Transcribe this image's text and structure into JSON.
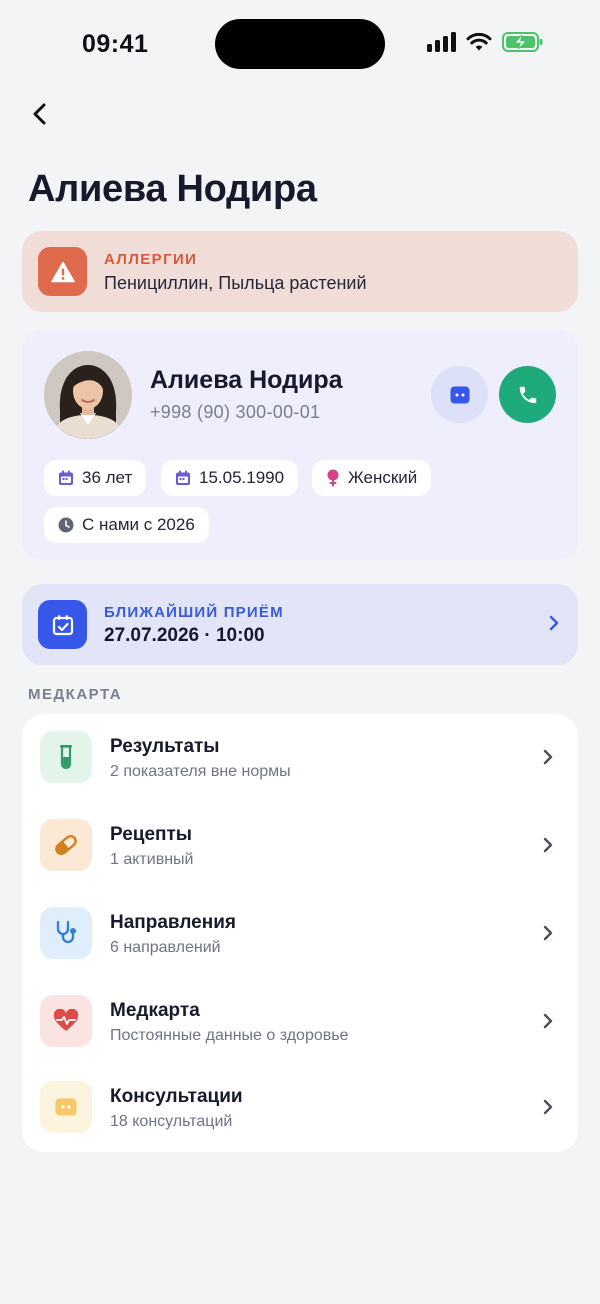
{
  "status_bar": {
    "time": "09:41"
  },
  "header": {
    "title": "Алиева Нодира"
  },
  "allergy": {
    "title": "АЛЛЕРГИИ",
    "text": "Пенициллин, Пыльца растений",
    "accent": "#df6a4c",
    "icon": "warning-icon"
  },
  "profile": {
    "name": "Алиева Нодира",
    "phone": "+998 (90) 300-00-01",
    "chips": {
      "age": "36 лет",
      "birthdate": "15.05.1990",
      "gender": "Женский",
      "since": "С нами с 2026"
    }
  },
  "appointment": {
    "title": "БЛИЖАЙШИЙ ПРИЁМ",
    "datetime": "27.07.2026 · 10:00",
    "accent": "#3658ea",
    "icon": "calendar-check-icon"
  },
  "medcard": {
    "section_label": "МЕДКАРТА",
    "items": [
      {
        "title": "Результаты",
        "subtitle": "2 показателя вне нормы",
        "icon": "test-tube-icon"
      },
      {
        "title": "Рецепты",
        "subtitle": "1 активный",
        "icon": "pill-icon"
      },
      {
        "title": "Направления",
        "subtitle": "6 направлений",
        "icon": "stethoscope-icon"
      },
      {
        "title": "Медкарта",
        "subtitle": "Постоянные данные о здоровье",
        "icon": "heart-pulse-icon"
      },
      {
        "title": "Консультации",
        "subtitle": "18 консультаций",
        "icon": "chat-icon"
      }
    ]
  },
  "colors": {
    "call_green": "#1faa7b",
    "chip_icon_purple": "#6b5bd6",
    "female_pink": "#d9418a"
  }
}
